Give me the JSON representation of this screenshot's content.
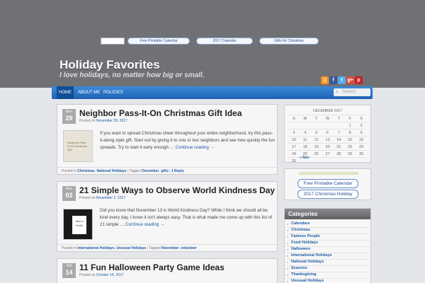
{
  "banners": {
    "items": [
      "Free Printable Calendar",
      "2017 Calendar",
      "Gifts for Christmas"
    ]
  },
  "site": {
    "title": "Holiday Favorites",
    "tagline": "I love holidays, no matter how big or small."
  },
  "social": {
    "icons": [
      "rss-icon",
      "facebook-icon",
      "twitter-icon",
      "google-plus-icon",
      "pinterest-icon"
    ],
    "colors": [
      "#f7931e",
      "#3b5998",
      "#55acee",
      "#dd4b39",
      "#cb2027"
    ]
  },
  "nav": {
    "items": [
      "HOME",
      "ABOUT ME",
      "POLICIES"
    ],
    "search_placeholder": "Search"
  },
  "posts": [
    {
      "month": "Nov",
      "day": "29",
      "title": "Neighbor Pass-It-On Christmas Gift Idea",
      "meta_prefix": "Posted on",
      "date": "November 29, 2017",
      "thumb_text": "Neighbor Pass-It-On Christmas Gift",
      "body": "If you want to spread Christmas cheer throughout your entire neighborhood, try this pass-it-along style gift. Start out by giving it to one or two neighbors and see how quickly the fun spreads. Try to start it early enough …",
      "more": "Continue reading →",
      "footer_prefix": "Posted in",
      "categories": [
        "Christmas",
        "National Holidays"
      ],
      "tagged_prefix": "Tagged",
      "tags": [
        "December",
        "gifts"
      ],
      "reply": "1 Reply"
    },
    {
      "month": "Nov",
      "day": "02",
      "title": "21 Simple Ways to Observe World Kindness Day",
      "meta_prefix": "Posted on",
      "date": "November 2, 2017",
      "thumb_text": "Take a Smile",
      "body": "Did you know that November 13 is World Kindness Day? While I think we should all be kind every day, I know it isn't always easy. That is what made me come up with this list of 21 simple …",
      "more": "Continue reading →",
      "footer_prefix": "Posted in",
      "categories": [
        "International Holidays",
        "Unusual Holidays"
      ],
      "tagged_prefix": "Tagged",
      "tags": [
        "November",
        "volunteer"
      ]
    },
    {
      "month": "Oct",
      "day": "14",
      "title": "11 Fun Halloween Party Game Ideas",
      "meta_prefix": "Posted on",
      "date": "October 14, 2017"
    }
  ],
  "calendar": {
    "title": "DECEMBER 2017",
    "weekdays": [
      "S",
      "M",
      "T",
      "W",
      "T",
      "F",
      "S"
    ],
    "rows": [
      [
        "",
        "",
        "",
        "",
        "",
        "1",
        "2"
      ],
      [
        "3",
        "4",
        "5",
        "6",
        "7",
        "8",
        "9"
      ],
      [
        "10",
        "11",
        "12",
        "13",
        "14",
        "15",
        "16"
      ],
      [
        "17",
        "18",
        "19",
        "20",
        "21",
        "22",
        "23"
      ],
      [
        "24",
        "25",
        "26",
        "27",
        "28",
        "29",
        "30"
      ],
      [
        "31",
        "",
        "",
        "",
        "",
        "",
        ""
      ]
    ],
    "prev": "« Nov"
  },
  "links": [
    "Free Printable Calendar",
    "2017 Christmas Holiday"
  ],
  "categories": {
    "title": "Categories",
    "items": [
      "Calendars",
      "Christmas",
      "Famous People",
      "Food Holidays",
      "Halloween",
      "International Holidays",
      "National Holidays",
      "Seasons",
      "Thanksgiving",
      "Unusual Holidays"
    ]
  }
}
